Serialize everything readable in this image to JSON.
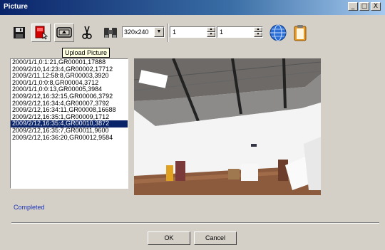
{
  "window": {
    "title": "Picture",
    "minimize": "_",
    "maximize": "□",
    "close": "X"
  },
  "toolbar": {
    "resolution": "320x240",
    "spin1_value": "1",
    "spin2_value": "1",
    "tooltip": "Upload Picture"
  },
  "list": {
    "items": [
      "2000/1/1,0:1:21,GR00001,17888",
      "2009/2/10,14:23:4,GR00002,17712",
      "2009/2/11,12:58:8,GR00003,3920",
      "2000/1/1,0:0:8,GR00004,3712",
      "2000/1/1,0:0:13,GR00005,3984",
      "2009/2/12,16:32:15,GR00006,3792",
      "2009/2/12,16:34:4,GR00007,3792",
      "2009/2/12,16:34:11,GR00008,16688",
      "2009/2/12,16:35:1,GR00009,1712",
      "2009/2/12,16:35:4,GR00010,3872",
      "2009/2/12,16:35:7,GR00011,9600",
      "2009/2/12,16:36:20,GR00012,9584"
    ],
    "selected_index": 9
  },
  "status": "Completed",
  "buttons": {
    "ok": "OK",
    "cancel": "Cancel"
  }
}
